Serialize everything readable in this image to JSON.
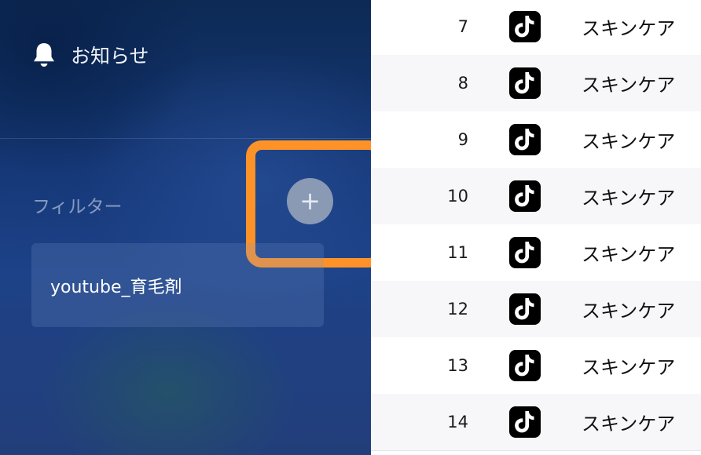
{
  "sidebar": {
    "notification": {
      "icon": "bell-icon",
      "label": "お知らせ"
    },
    "filter": {
      "label": "フィルター",
      "add_button": {
        "icon": "plus-icon",
        "label": "+"
      },
      "items": [
        {
          "label": "youtube_育毛剤"
        }
      ]
    },
    "highlight_color": "#fd9328"
  },
  "table": {
    "rows": [
      {
        "number": "7",
        "platform_icon": "tiktok-icon",
        "category": "スキンケア"
      },
      {
        "number": "8",
        "platform_icon": "tiktok-icon",
        "category": "スキンケア"
      },
      {
        "number": "9",
        "platform_icon": "tiktok-icon",
        "category": "スキンケア"
      },
      {
        "number": "10",
        "platform_icon": "tiktok-icon",
        "category": "スキンケア"
      },
      {
        "number": "11",
        "platform_icon": "tiktok-icon",
        "category": "スキンケア"
      },
      {
        "number": "12",
        "platform_icon": "tiktok-icon",
        "category": "スキンケア"
      },
      {
        "number": "13",
        "platform_icon": "tiktok-icon",
        "category": "スキンケア"
      },
      {
        "number": "14",
        "platform_icon": "tiktok-icon",
        "category": "スキンケア"
      }
    ],
    "alt_row_color": "#f7f7f9"
  }
}
